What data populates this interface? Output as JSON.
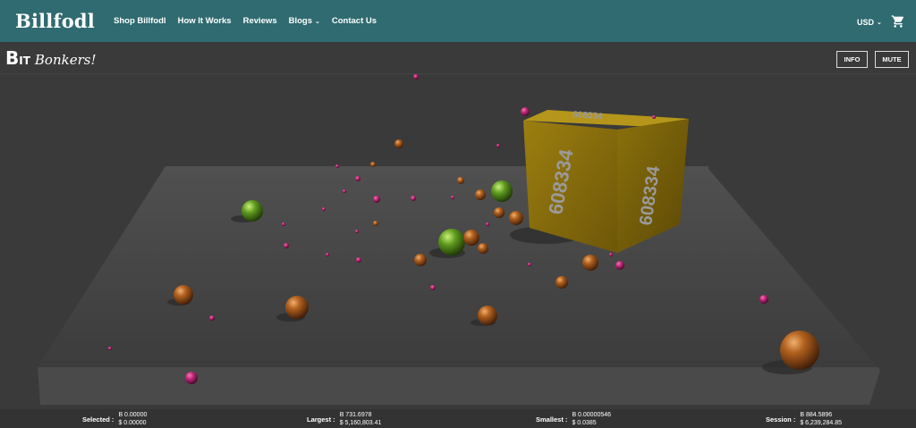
{
  "site": {
    "logo": "Billfodl",
    "nav": [
      {
        "label": "Shop Billfodl",
        "has_dropdown": false
      },
      {
        "label": "How It Works",
        "has_dropdown": false
      },
      {
        "label": "Reviews",
        "has_dropdown": false
      },
      {
        "label": "Blogs",
        "has_dropdown": true
      },
      {
        "label": "Contact Us",
        "has_dropdown": false
      }
    ],
    "currency": "USD",
    "cart_icon": "shopping-cart-icon",
    "colors": {
      "header_bg": "#2f6b70",
      "game_bg": "#3a3a3a"
    }
  },
  "game": {
    "logo_b": "B",
    "logo_it": "IT",
    "logo_rest": "Bonkers!",
    "info_button": "INFO",
    "mute_button": "MUTE",
    "cube_label": "608334",
    "ball_colors": {
      "bronze": "#b3621f",
      "green": "#5f9a1e",
      "magenta": "#c0287a"
    }
  },
  "stats": {
    "selected": {
      "label": "Selected :",
      "btc": "B 0.00000",
      "usd": "$ 0.00000"
    },
    "largest": {
      "label": "Largest :",
      "btc": "B 731.6978",
      "usd": "$ 5,160,803.41"
    },
    "smallest": {
      "label": "Smallest :",
      "btc": "B 0.00000546",
      "usd": "$ 0.0385"
    },
    "session": {
      "label": "Session :",
      "btc": "B 884.5896",
      "usd": "$ 6,239,284.85"
    }
  }
}
